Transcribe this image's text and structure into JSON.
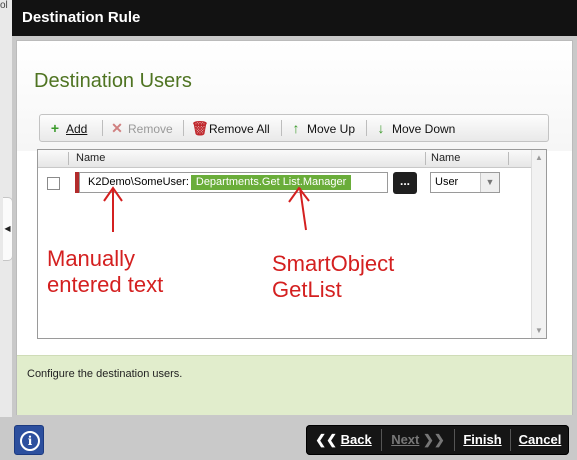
{
  "window": {
    "title": "Destination Rule"
  },
  "background": {
    "fragment": "ol"
  },
  "section": {
    "heading": "Destination Users"
  },
  "toolbar": {
    "add_label": "Add",
    "remove_label": "Remove",
    "remove_all_label": "Remove All",
    "move_up_label": "Move Up",
    "move_down_label": "Move Down"
  },
  "grid": {
    "columns": [
      "Name",
      "Name"
    ],
    "rows": [
      {
        "text": "K2Demo\\SomeUser:",
        "token": "Departments.Get List.Manager",
        "browse_label": "...",
        "type": "User"
      }
    ]
  },
  "annotations": {
    "left": [
      "Manually",
      "entered text"
    ],
    "right": [
      "SmartObject",
      "GetList"
    ]
  },
  "footer": {
    "text": "Configure the destination users."
  },
  "side_tab": {
    "glyph": "◀"
  },
  "info": {
    "glyph": "i"
  },
  "nav": {
    "back": "Back",
    "next": "Next",
    "finish": "Finish",
    "cancel": "Cancel"
  },
  "colors": {
    "heading": "#4f7422",
    "token": "#6aad3a",
    "annotation": "#d42020",
    "row_marker": "#b22b2b"
  },
  "icons": [
    "plus-icon",
    "x-icon",
    "trash-icon",
    "arrow-up-icon",
    "arrow-down-icon",
    "info-icon",
    "chevron-down-icon",
    "double-left-chevron-icon",
    "double-right-chevron-icon"
  ]
}
